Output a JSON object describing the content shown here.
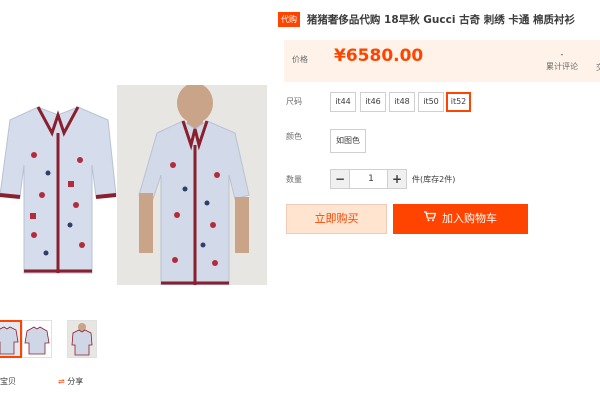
{
  "product": {
    "tag": "代购",
    "title": "猪猪奢侈品代购 18早秋 Gucci 古奇 刺绣 卡通 棉质衬衫"
  },
  "price": {
    "label": "价格",
    "value": "¥6580.00"
  },
  "stats": {
    "reviews_value": "-",
    "reviews_label": "累计评论",
    "trade_label": "交"
  },
  "size": {
    "label": "尺码",
    "options": [
      "it44",
      "it46",
      "it48",
      "it50",
      "it52"
    ],
    "selected": "it52"
  },
  "color": {
    "label": "颜色",
    "options": [
      "如图色"
    ]
  },
  "quantity": {
    "label": "数量",
    "minus": "−",
    "value": "1",
    "plus": "+",
    "stock": "件(库存2件)"
  },
  "buttons": {
    "buy_now": "立即购买",
    "add_to_cart": "加入购物车"
  },
  "actions": {
    "favorite": "宝贝",
    "share": "分享"
  },
  "colors": {
    "accent": "#ff4400",
    "price_bg": "#fff2e8"
  }
}
